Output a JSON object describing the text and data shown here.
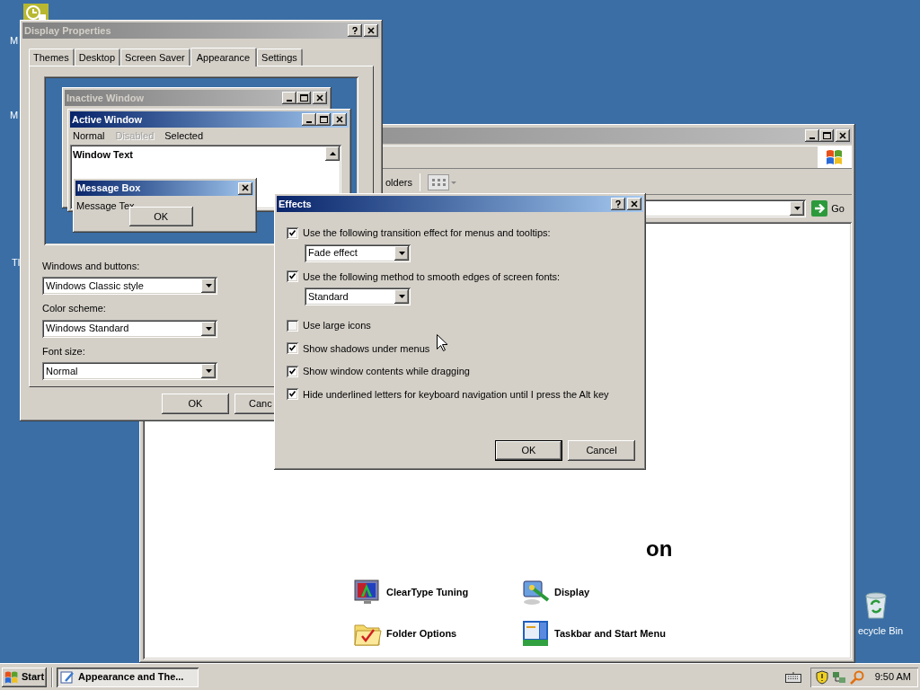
{
  "desktop": {
    "icon_labels": [
      {
        "text": "M"
      },
      {
        "text": "M"
      },
      {
        "text": "Tl"
      },
      {
        "text": "ecycle Bin"
      }
    ]
  },
  "back_window": {
    "active": false,
    "toolbar_text": "olders",
    "go": "Go",
    "heading": "on",
    "tasks": [
      {
        "label": "ClearType Tuning"
      },
      {
        "label": "Display"
      },
      {
        "label": "Folder Options"
      },
      {
        "label": "Taskbar and Start Menu"
      }
    ]
  },
  "display_properties": {
    "title": "Display Properties",
    "active": false,
    "tabs": [
      {
        "label": "Themes",
        "selected": false
      },
      {
        "label": "Desktop",
        "selected": false
      },
      {
        "label": "Screen Saver",
        "selected": false
      },
      {
        "label": "Appearance",
        "selected": true
      },
      {
        "label": "Settings",
        "selected": false
      }
    ],
    "preview": {
      "inactive_title": "Inactive Window",
      "active_title": "Active Window",
      "menu": [
        {
          "label": "Normal",
          "disabled": false
        },
        {
          "label": "Disabled",
          "disabled": true
        },
        {
          "label": "Selected",
          "disabled": false
        }
      ],
      "window_text": "Window Text",
      "message_title": "Message Box",
      "message_text": "Message Tex",
      "message_button": "OK"
    },
    "fields": [
      {
        "label": "Windows and buttons:",
        "value": "Windows Classic style"
      },
      {
        "label": "Color scheme:",
        "value": "Windows Standard"
      },
      {
        "label": "Font size:",
        "value": "Normal"
      }
    ],
    "buttons": [
      "OK",
      "Canc"
    ]
  },
  "effects": {
    "title": "Effects",
    "active": true,
    "options": [
      {
        "label": "Use the following transition effect for menus and tooltips:",
        "checked": true,
        "value": "Fade effect"
      },
      {
        "label": "Use the following method to smooth edges of screen fonts:",
        "checked": true,
        "value": "Standard"
      },
      {
        "label": "Use large icons",
        "checked": false
      },
      {
        "label": "Show shadows under menus",
        "checked": true
      },
      {
        "label": "Show window contents while dragging",
        "checked": true
      },
      {
        "label": "Hide underlined letters for keyboard navigation until I press the Alt key",
        "checked": true
      }
    ],
    "buttons": [
      "OK",
      "Cancel"
    ]
  },
  "taskbar": {
    "start": "Start",
    "tasks": [
      {
        "label": "Appearance and The...",
        "selected": true
      }
    ],
    "clock": "9:50 AM"
  }
}
